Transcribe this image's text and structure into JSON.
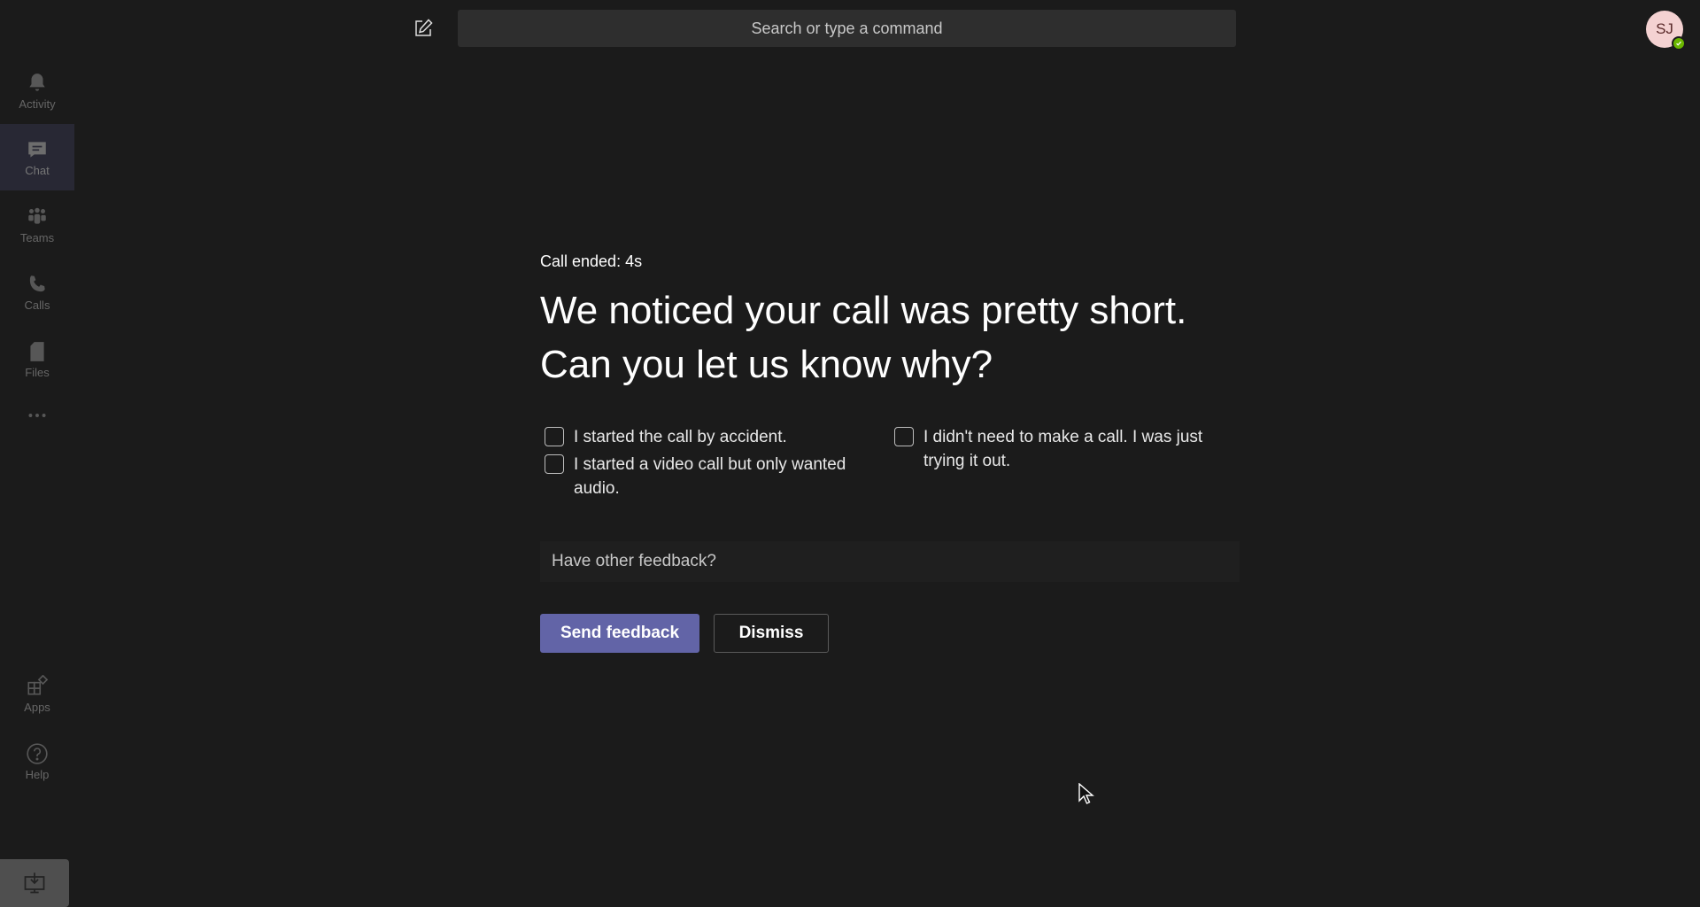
{
  "topbar": {
    "compose_icon": "compose-icon",
    "search_placeholder": "Search or type a command",
    "avatar_initials": "SJ",
    "presence_status": "available",
    "presence_color": "#6bb700"
  },
  "rail": {
    "items": [
      {
        "label": "Activity",
        "icon": "bell-icon"
      },
      {
        "label": "Chat",
        "icon": "chat-icon",
        "active": true
      },
      {
        "label": "Teams",
        "icon": "teams-icon"
      },
      {
        "label": "Calls",
        "icon": "phone-icon"
      },
      {
        "label": "Files",
        "icon": "file-icon"
      },
      {
        "label": "",
        "icon": "more-icon"
      },
      {
        "label": "Apps",
        "icon": "apps-icon"
      },
      {
        "label": "Help",
        "icon": "help-icon"
      }
    ],
    "download_icon": "download-app-icon"
  },
  "feedback": {
    "call_ended": "Call ended: 4s",
    "headline_line1": "We noticed your call was pretty short.",
    "headline_line2": "Can you let us know why?",
    "options": [
      {
        "label": "I started the call by accident.",
        "checked": false
      },
      {
        "label": "I started a video call but only wanted audio.",
        "checked": false
      },
      {
        "label": "I didn't need to make a call. I was just trying it out.",
        "checked": false
      }
    ],
    "other_placeholder": "Have other feedback?",
    "send_label": "Send feedback",
    "dismiss_label": "Dismiss"
  },
  "colors": {
    "accent": "#6264a7",
    "background": "#1b1b1b",
    "search_bg": "#2e2e2e",
    "avatar_bg": "#f4d2d2"
  }
}
